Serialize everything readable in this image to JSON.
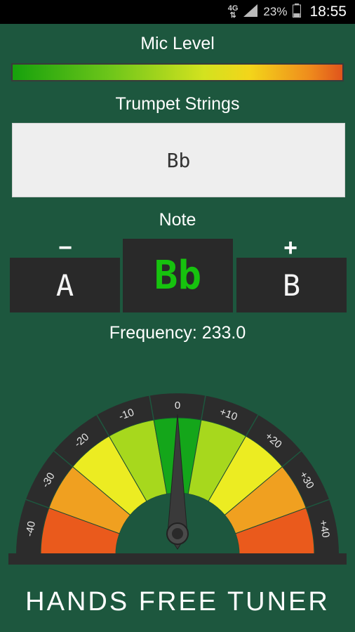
{
  "status_bar": {
    "network": "4G",
    "battery": "23%",
    "time": "18:55"
  },
  "mic_level": {
    "label": "Mic Level"
  },
  "strings": {
    "label": "Trumpet Strings",
    "value": "Bb"
  },
  "note": {
    "label": "Note",
    "minus_symbol": "−",
    "plus_symbol": "+",
    "prev": "A",
    "current": "Bb",
    "next": "B"
  },
  "frequency": {
    "text": "Frequency: 233.0"
  },
  "gauge": {
    "ticks": [
      "-40",
      "-30",
      "-20",
      "-10",
      "0",
      "+10",
      "+20",
      "+30",
      "+40"
    ],
    "needle_cents": 0,
    "range": [
      -45,
      45
    ],
    "colors": {
      "outer_ring": "#2c2c2c",
      "center": "#14a61a",
      "near": "#a7d81d",
      "mid": "#ecec22",
      "far": "#f0a020",
      "edge": "#ea5a1c"
    }
  },
  "footer": {
    "title": "HANDS FREE TUNER"
  }
}
